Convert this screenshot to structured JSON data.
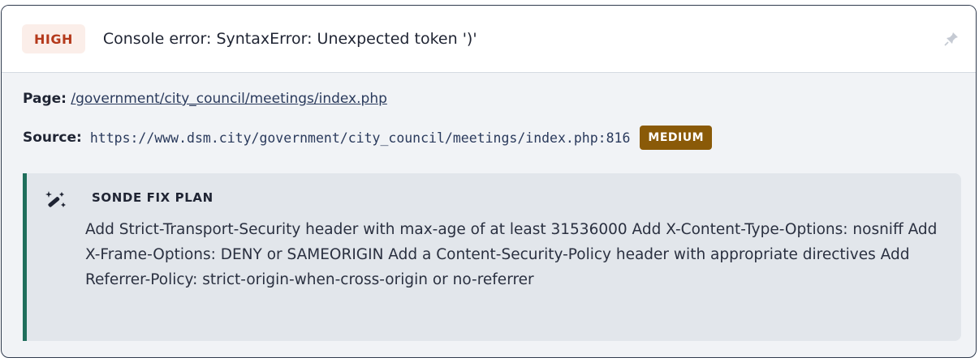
{
  "finding": {
    "severity": "HIGH",
    "title": "Console error: SyntaxError: Unexpected token ')'",
    "page_label": "Page:",
    "page_path": "/government/city_council/meetings/index.php",
    "source_label": "Source:",
    "source_url": "https://www.dsm.city/government/city_council/meetings/index.php:816",
    "source_severity": "MEDIUM"
  },
  "fix_plan": {
    "title": "SONDE FIX PLAN",
    "text": "Add Strict-Transport-Security header with max-age of at least 31536000 Add X-Content-Type-Options: nosniff Add X-Frame-Options: DENY or SAMEORIGIN Add a Content-Security-Policy header with appropriate directives Add Referrer-Policy: strict-origin-when-cross-origin or no-referrer"
  },
  "icons": {
    "pin": "pin-icon",
    "fix": "magic-wand-icon"
  },
  "colors": {
    "high": "#b4391b",
    "medium": "#8a5a08",
    "accent": "#1f6e5b"
  }
}
